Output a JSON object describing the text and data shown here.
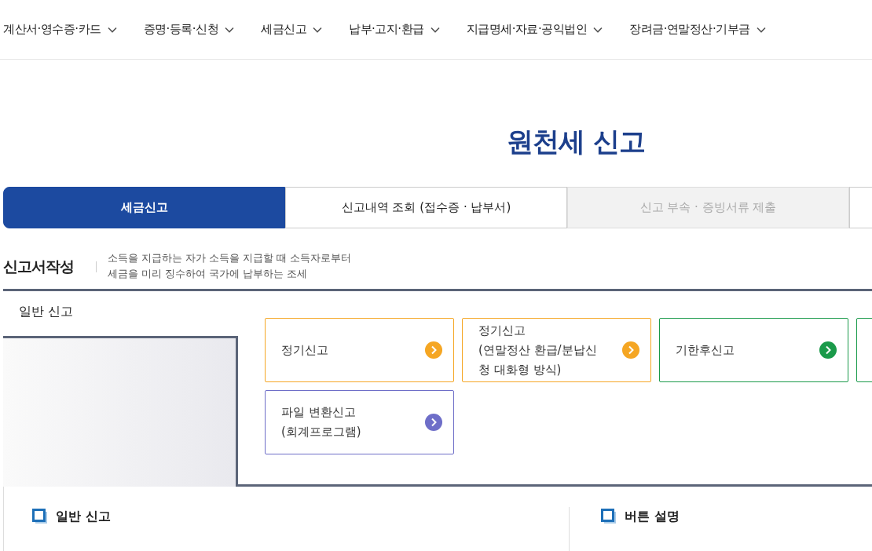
{
  "nav": [
    "계산서·영수증·카드",
    "증명·등록·신청",
    "세금신고",
    "납부·고지·환급",
    "지급명세·자료·공익법인",
    "장려금·연말정산·기부금"
  ],
  "title": "원천세 신고",
  "tabs": [
    {
      "label": "세금신고",
      "selected": true,
      "disabled": false
    },
    {
      "label": "신고내역 조회 (접수증 · 납부서)",
      "selected": false,
      "disabled": false
    },
    {
      "label": "신고 부속 · 증빙서류 제출",
      "selected": false,
      "disabled": true
    },
    {
      "selected": false,
      "disabled": false
    }
  ],
  "section": {
    "title": "신고서작성",
    "description": "소득을 지급하는 자가 소득을 지급할 때 소득자로부터\n세금을 미리 징수하여 국가에 납부하는 조세"
  },
  "panel": {
    "tab": "일반 신고",
    "cards": [
      {
        "label": "정기신고",
        "color": "#f5a623"
      },
      {
        "label": "정기신고\n(연말정산 환급/분납신\n청 대화형 방식)",
        "color": "#f5a623"
      },
      {
        "label": "기한후신고",
        "color": "#1a9a4a"
      },
      {
        "color": "#1a9a4a"
      },
      {
        "label": "파일 변환신고\n(회계프로그램)",
        "color": "#6e6ec8"
      }
    ]
  },
  "bottom": [
    "일반 신고",
    "버튼 설명"
  ]
}
